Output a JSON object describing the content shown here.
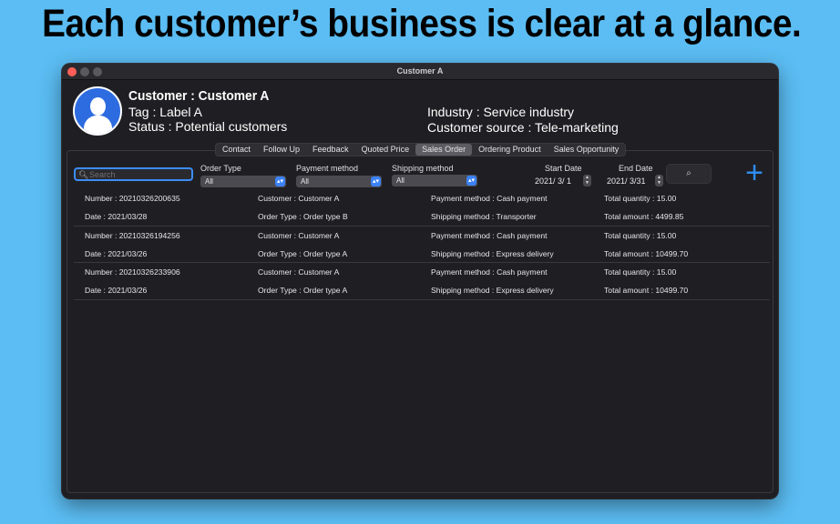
{
  "headline": "Each customer’s business is clear at a glance.",
  "window": {
    "title": "Customer A"
  },
  "customer": {
    "name": "Customer : Customer A",
    "tag": "Tag : Label A",
    "status": "Status : Potential customers",
    "industry": "Industry : Service industry",
    "source": "Customer source : Tele-marketing"
  },
  "tabs": [
    {
      "label": "Contact"
    },
    {
      "label": "Follow Up"
    },
    {
      "label": "Feedback"
    },
    {
      "label": "Quoted Price"
    },
    {
      "label": "Sales Order",
      "active": true
    },
    {
      "label": "Ordering Product"
    },
    {
      "label": "Sales Opportunity"
    }
  ],
  "filters": {
    "search_placeholder": "Search",
    "order_type": {
      "label": "Order Type",
      "value": "All"
    },
    "payment_method": {
      "label": "Payment method",
      "value": "All"
    },
    "shipping_method": {
      "label": "Shipping method",
      "value": "All"
    },
    "start_date": {
      "label": "Start Date",
      "value": "2021/  3/  1"
    },
    "end_date": {
      "label": "End Date",
      "value": "2021/  3/31"
    }
  },
  "orders": [
    {
      "number": "Number : 20210326200635",
      "date": "Date : 2021/03/28",
      "customer": "Customer : Customer A",
      "order_type": "Order Type : Order type B",
      "payment": "Payment method : Cash payment",
      "shipping": "Shipping method : Transporter",
      "quantity": "Total quantity : 15.00",
      "amount": "Total amount : 4499.85"
    },
    {
      "number": "Number : 20210326194256",
      "date": "Date : 2021/03/26",
      "customer": "Customer : Customer A",
      "order_type": "Order Type : Order type A",
      "payment": "Payment method : Cash payment",
      "shipping": "Shipping method : Express delivery",
      "quantity": "Total quantity : 15.00",
      "amount": "Total amount : 10499.70"
    },
    {
      "number": "Number : 20210326233906",
      "date": "Date : 2021/03/26",
      "customer": "Customer : Customer A",
      "order_type": "Order Type : Order type A",
      "payment": "Payment method : Cash payment",
      "shipping": "Shipping method : Express delivery",
      "quantity": "Total quantity : 15.00",
      "amount": "Total amount : 10499.70"
    }
  ],
  "icons": {
    "search": "magnifier-icon",
    "add": "plus-icon",
    "avatar": "person-icon"
  },
  "colors": {
    "background": "#5bbdf3",
    "accent": "#3b82f6",
    "avatar": "#2d6ce0"
  }
}
